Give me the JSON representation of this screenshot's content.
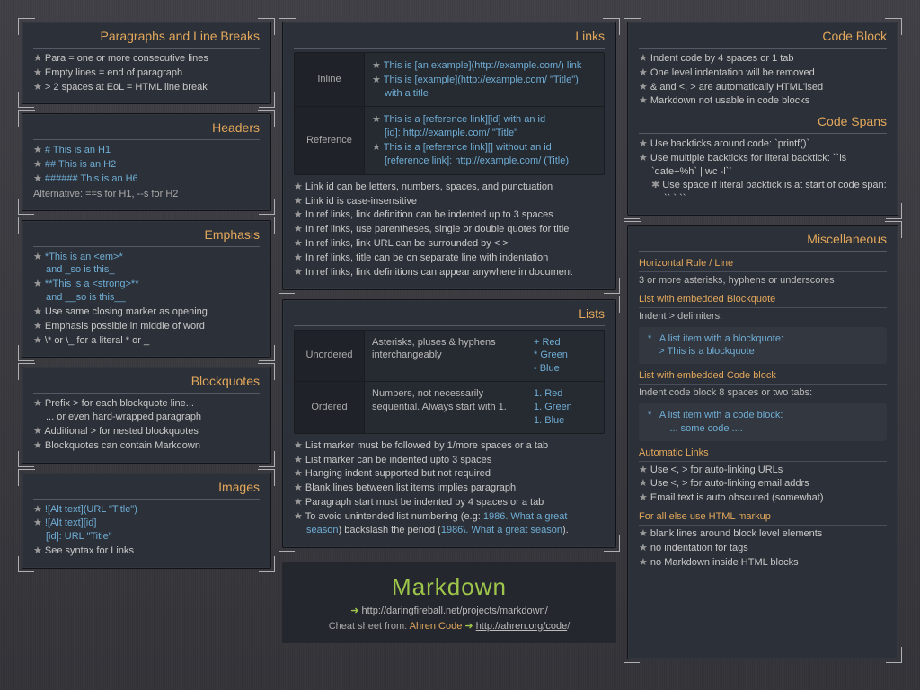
{
  "left": {
    "para": {
      "title": "Paragraphs and Line Breaks",
      "i0": "Para = one or more consecutive lines",
      "i1": "Empty lines = end of paragraph",
      "i2": "> 2 spaces at EoL = HTML line break"
    },
    "headers": {
      "title": "Headers",
      "i0": "# This is an H1",
      "i1": "## This is an H2",
      "i2": "###### This is an H6",
      "alt": "Alternative: ==s for H1, --s for H2"
    },
    "emph": {
      "title": "Emphasis",
      "i0a": "*This is an <em>*",
      "i0b": "and _so is this_",
      "i1a": "**This is a <strong>**",
      "i1b": "and __so is this__",
      "i2": "Use same closing marker as opening",
      "i3": "Emphasis possible in middle of word",
      "i4": "\\* or \\_ for a literal * or _"
    },
    "bq": {
      "title": "Blockquotes",
      "i0a": "Prefix > for each blockquote line...",
      "i0b": "... or even hard-wrapped paragraph",
      "i1": "Additional > for nested blockquotes",
      "i2": "Blockquotes can contain Markdown"
    },
    "img": {
      "title": "Images",
      "i0": "![Alt text](URL \"Title\")",
      "i1a": "![Alt text][id]",
      "i1b": "[id]: URL \"Title\"",
      "i2": "See syntax for Links"
    }
  },
  "mid": {
    "links": {
      "title": "Links",
      "inline_label": "Inline",
      "inline_i0": "This is [an example](http://example.com/) link",
      "inline_i1": "This is [example](http://example.com/ \"Title\") with a title",
      "ref_label": "Reference",
      "ref_i0a": "This is a [reference link][id] with an id",
      "ref_i0b": "[id]: http://example.com/ \"Title\"",
      "ref_i1a": "This is a [reference link][] without an id",
      "ref_i1b": "[reference link]: http://example.com/ (Title)",
      "n0": "Link id can be letters, numbers, spaces, and punctuation",
      "n1": "Link id is case-insensitive",
      "n2": "In ref links, link definition can be indented up to 3 spaces",
      "n3": "In ref links, use parentheses, single or double quotes for title",
      "n4": "In ref links, link URL can be surrounded by < >",
      "n5": "In ref links, title can be on separate line with indentation",
      "n6": "In ref links, link definitions can appear anywhere in document"
    },
    "lists": {
      "title": "Lists",
      "u_label": "Unordered",
      "u_desc": "Asterisks, pluses & hyphens interchangeably",
      "u_ex": "+ Red\n* Green\n- Blue",
      "o_label": "Ordered",
      "o_desc": "Numbers, not necessarily sequential. Always start with 1.",
      "o_ex": "1. Red\n1. Green\n1. Blue",
      "n0": "List marker must be followed by 1/more spaces or a tab",
      "n1": "List marker can be indented upto 3 spaces",
      "n2": "Hanging indent supported but not required",
      "n3": "Blank lines between list items implies paragraph",
      "n4": "Paragraph start must be indented by 4 spaces or a tab",
      "n5a": "To avoid unintended list numbering (e.g: ",
      "n5b": "1986. What a great season",
      "n5c": ") backslash the period (",
      "n5d": "1986\\. What a great season",
      "n5e": ")."
    },
    "brand": {
      "title": "Markdown",
      "url": "http://daringfireball.net/projects/markdown/",
      "cs_pre": "Cheat sheet from: ",
      "cs_name": "Ahren Code",
      "cs_url": "http://ahren.org/code",
      "slash": "/"
    }
  },
  "right": {
    "codeblock": {
      "title": "Code Block",
      "i0": "Indent code by 4 spaces or 1 tab",
      "i1": "One level indentation will be removed",
      "i2": "& and <, > are automatically HTML'ised",
      "i3": "Markdown not usable in code blocks"
    },
    "codespans": {
      "title": "Code Spans",
      "i0": "Use backticks around code: `printf()`",
      "i1": "Use multiple backticks for literal backtick: ``ls `date+%h` | wc -l``",
      "i1sub": "Use space if literal backtick is at start of code span: `` ` ``"
    },
    "misc": {
      "title": "Miscellaneous",
      "hr_head": "Horizontal Rule / Line",
      "hr_text": "3 or more asterisks, hyphens or underscores",
      "bq_head": "List with embedded Blockquote",
      "bq_text": "Indent > delimiters:",
      "bq_snip": "*   A list item with a blockquote:\n    > This is a blockquote",
      "cb_head": "List with embedded Code block",
      "cb_text": "Indent code block 8 spaces or two tabs:",
      "cb_snip": "*   A list item with a code block:\n        ... some code ....",
      "auto_head": "Automatic Links",
      "auto_i0": "Use <, > for auto-linking URLs",
      "auto_i1": "Use <, > for auto-linking email addrs",
      "auto_i2": "Email text is auto obscured (somewhat)",
      "html_head": "For all else use HTML markup",
      "html_i0": "blank lines around block level elements",
      "html_i1": "no indentation for tags",
      "html_i2": "no Markdown inside HTML blocks"
    }
  }
}
